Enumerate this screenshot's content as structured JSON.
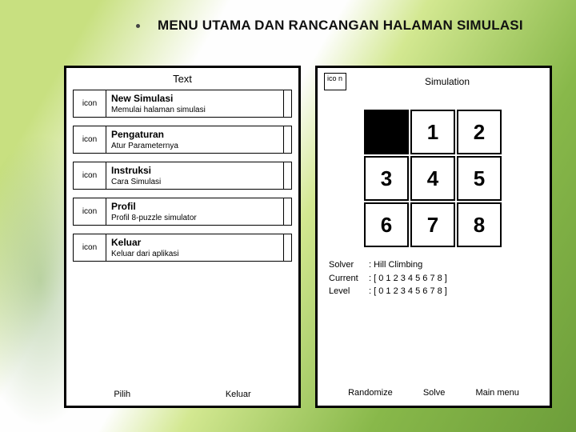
{
  "heading": "MENU UTAMA DAN RANCANGAN HALAMAN SIMULASI",
  "leftPanel": {
    "title": "Text",
    "iconPlaceholder": "icon",
    "items": [
      {
        "label": "New Simulasi",
        "desc": "Memulai halaman simulasi"
      },
      {
        "label": "Pengaturan",
        "desc": "Atur Parameternya"
      },
      {
        "label": "Instruksi",
        "desc": "Cara Simulasi"
      },
      {
        "label": "Profil",
        "desc": "Profil 8-puzzle simulator"
      },
      {
        "label": "Keluar",
        "desc": "Keluar dari aplikasi"
      }
    ],
    "footer": {
      "left": "Pilih",
      "right": "Keluar"
    }
  },
  "rightPanel": {
    "iconPlaceholder": "ico n",
    "title": "Simulation",
    "tiles": [
      "",
      "1",
      "2",
      "3",
      "4",
      "5",
      "6",
      "7",
      "8"
    ],
    "info": {
      "solver": {
        "k": "Solver",
        "v": ": Hill Climbing"
      },
      "current": {
        "k": "Current",
        "v": ": [ 0 1 2 3 4 5 6 7 8 ]"
      },
      "level": {
        "k": "Level",
        "v": ": [ 0 1 2 3 4 5 6 7 8 ]"
      }
    },
    "actions": {
      "randomize": "Randomize",
      "solve": "Solve",
      "mainmenu": "Main menu"
    }
  }
}
